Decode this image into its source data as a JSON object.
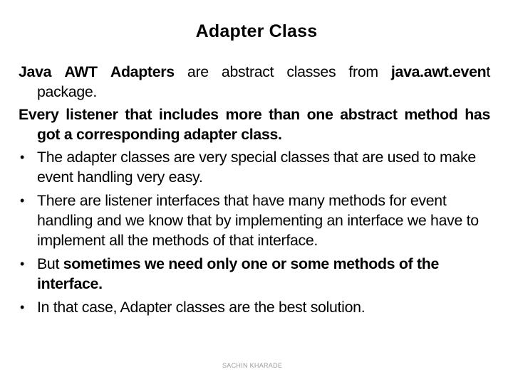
{
  "slide": {
    "title": "Adapter Class",
    "intro": {
      "p1": {
        "bold1": "Java",
        "bold2": "AWT",
        "bold3": "Adapters",
        "text1": " are abstract classes from ",
        "bold4": "java.awt.even",
        "text2": "t package."
      },
      "p2": {
        "bold": "Every listener that includes more than one abstract method has got a corresponding adapter class."
      }
    },
    "bullets": [
      {
        "icon": "bullet-dot",
        "text": "The adapter classes are very special classes that are used to make event handling very easy."
      },
      {
        "icon": "bullet-dot",
        "text": "There are listener interfaces that have many methods for event handling and we know that by implementing an interface we have to implement all the methods of that interface."
      },
      {
        "icon": "bullet-dot",
        "prefix": "But ",
        "bold": "sometimes we need only one or some methods of the interface."
      },
      {
        "icon": "bullet-dot",
        "text": "In that case, Adapter classes are the best solution."
      }
    ],
    "bullet_glyph": "•",
    "watermark": "SACHIN KHARADE"
  }
}
